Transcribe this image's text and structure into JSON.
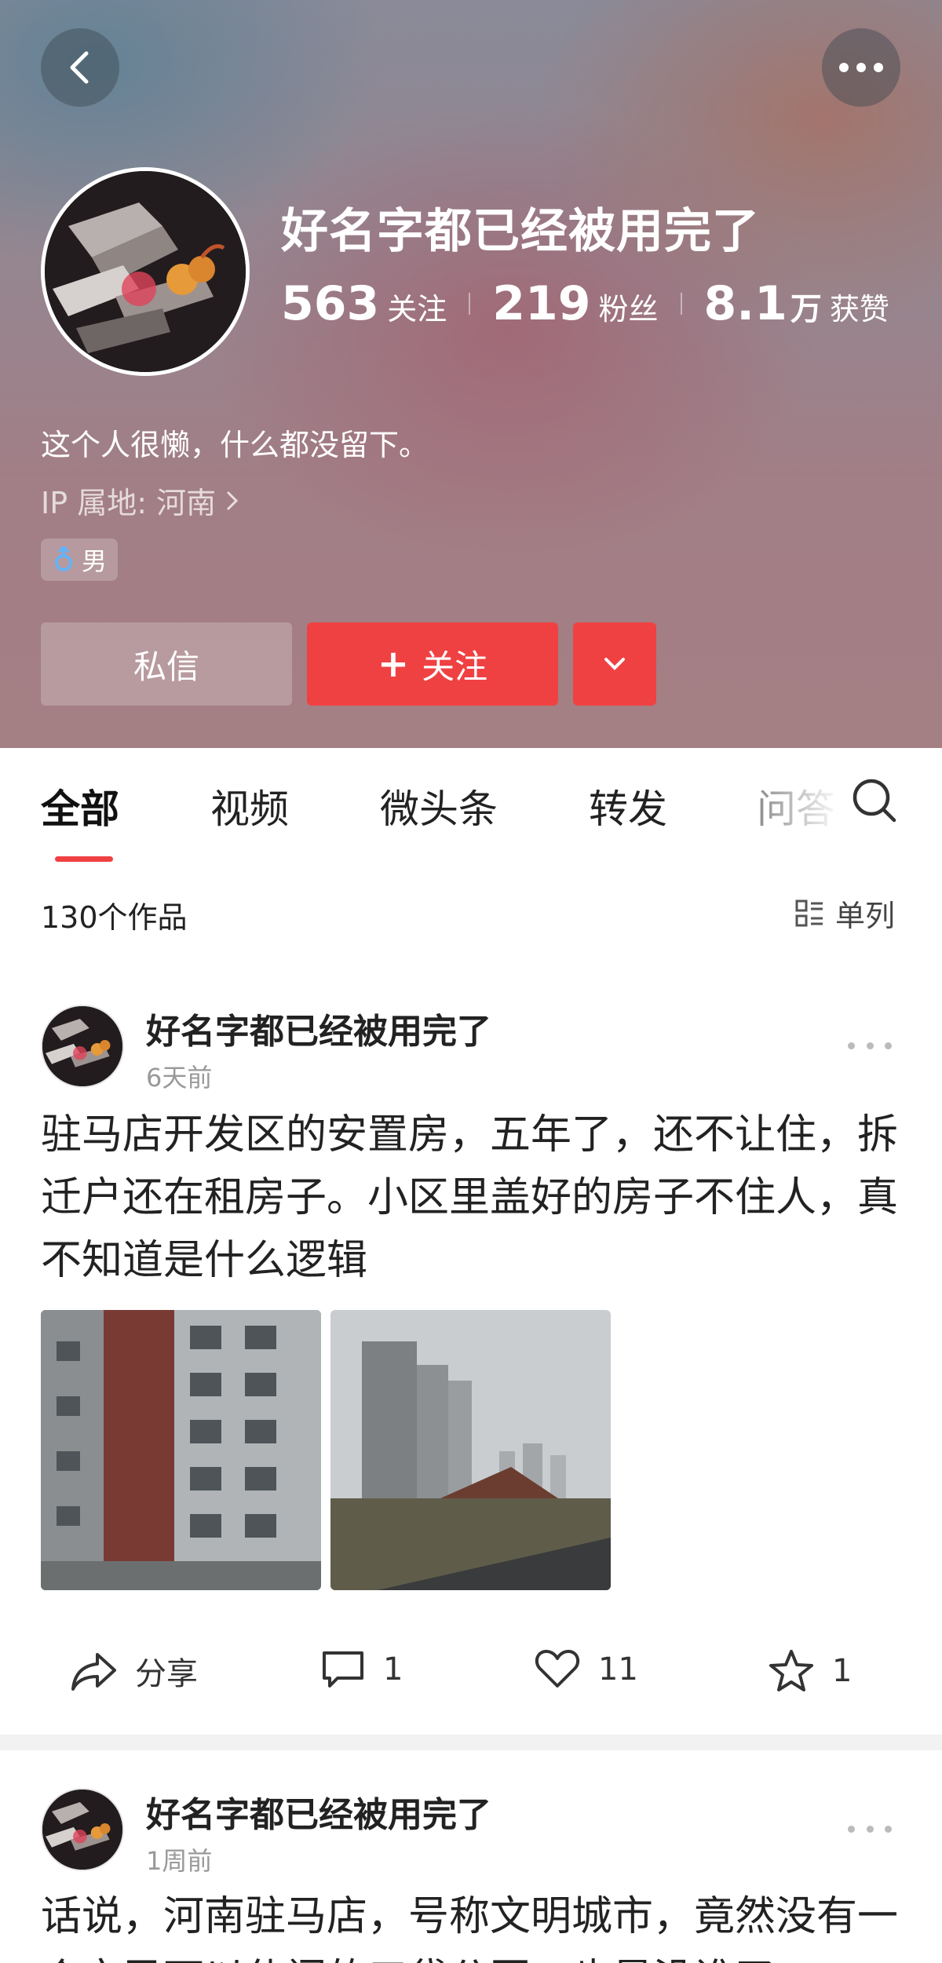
{
  "header": {
    "username": "好名字都已经被用完了",
    "stats": [
      {
        "num": "563",
        "unit": "",
        "label": "关注"
      },
      {
        "num": "219",
        "unit": "",
        "label": "粉丝"
      },
      {
        "num": "8.1",
        "unit": "万",
        "label": "获赞"
      }
    ],
    "bio": "这个人很懒，什么都没留下。",
    "ip_location": "IP 属地: 河南",
    "gender": "男",
    "message_label": "私信",
    "follow_label": "关注",
    "follow_plus": "+"
  },
  "tabs": [
    {
      "label": "全部"
    },
    {
      "label": "视频"
    },
    {
      "label": "微头条"
    },
    {
      "label": "转发"
    },
    {
      "label": "问答"
    }
  ],
  "works": {
    "count": "130个作品",
    "layout_label": "单列"
  },
  "posts": [
    {
      "author": "好名字都已经被用完了",
      "time": "6天前",
      "text": "驻马店开发区的安置房，五年了，还不让住，拆迁户还在租房子。小区里盖好的房子不住人，真不知道是什么逻辑",
      "share_label": "分享",
      "comments": "1",
      "likes": "11",
      "favorites": "1"
    },
    {
      "author": "好名字都已经被用完了",
      "time": "1周前",
      "text": "话说，河南驻马店，号称文明城市，竟然没有一个市民可以休闲的口袋公园，也是没谁了"
    }
  ],
  "colors": {
    "accent": "#f04142",
    "header_bg": "#958690"
  },
  "icons": {
    "back": "back-arrow-icon",
    "more": "more-dots-icon",
    "search": "search-icon",
    "layout": "list-layout-icon",
    "share": "share-icon",
    "comment": "comment-icon",
    "like": "heart-icon",
    "favorite": "star-icon"
  }
}
